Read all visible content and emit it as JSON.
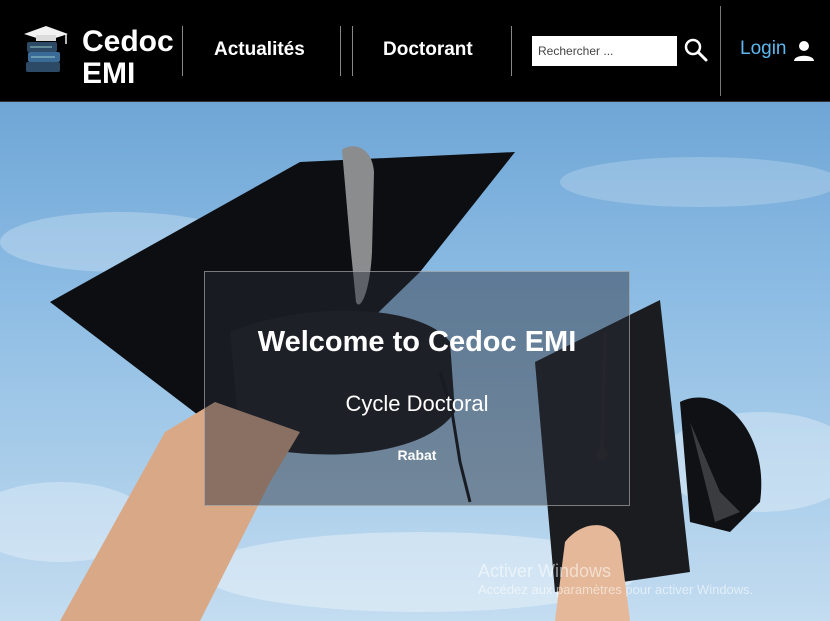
{
  "header": {
    "brand_line1": "Cedoc",
    "brand_line2": "EMI",
    "nav": [
      "Actualités",
      "Doctorant"
    ],
    "search_placeholder": "Rechercher ...",
    "login_label": "Login",
    "icons": {
      "logo": "graduation-books-logo",
      "search": "search-icon",
      "user": "user-icon"
    },
    "colors": {
      "background": "#000000",
      "login": "#5fb8ef"
    }
  },
  "hero": {
    "title": "Welcome to Cedoc EMI",
    "subtitle": "Cycle Doctoral",
    "location": "Rabat"
  },
  "watermark": {
    "line1": "Activer Windows",
    "line2": "Accédez aux paramètres pour activer Windows."
  }
}
